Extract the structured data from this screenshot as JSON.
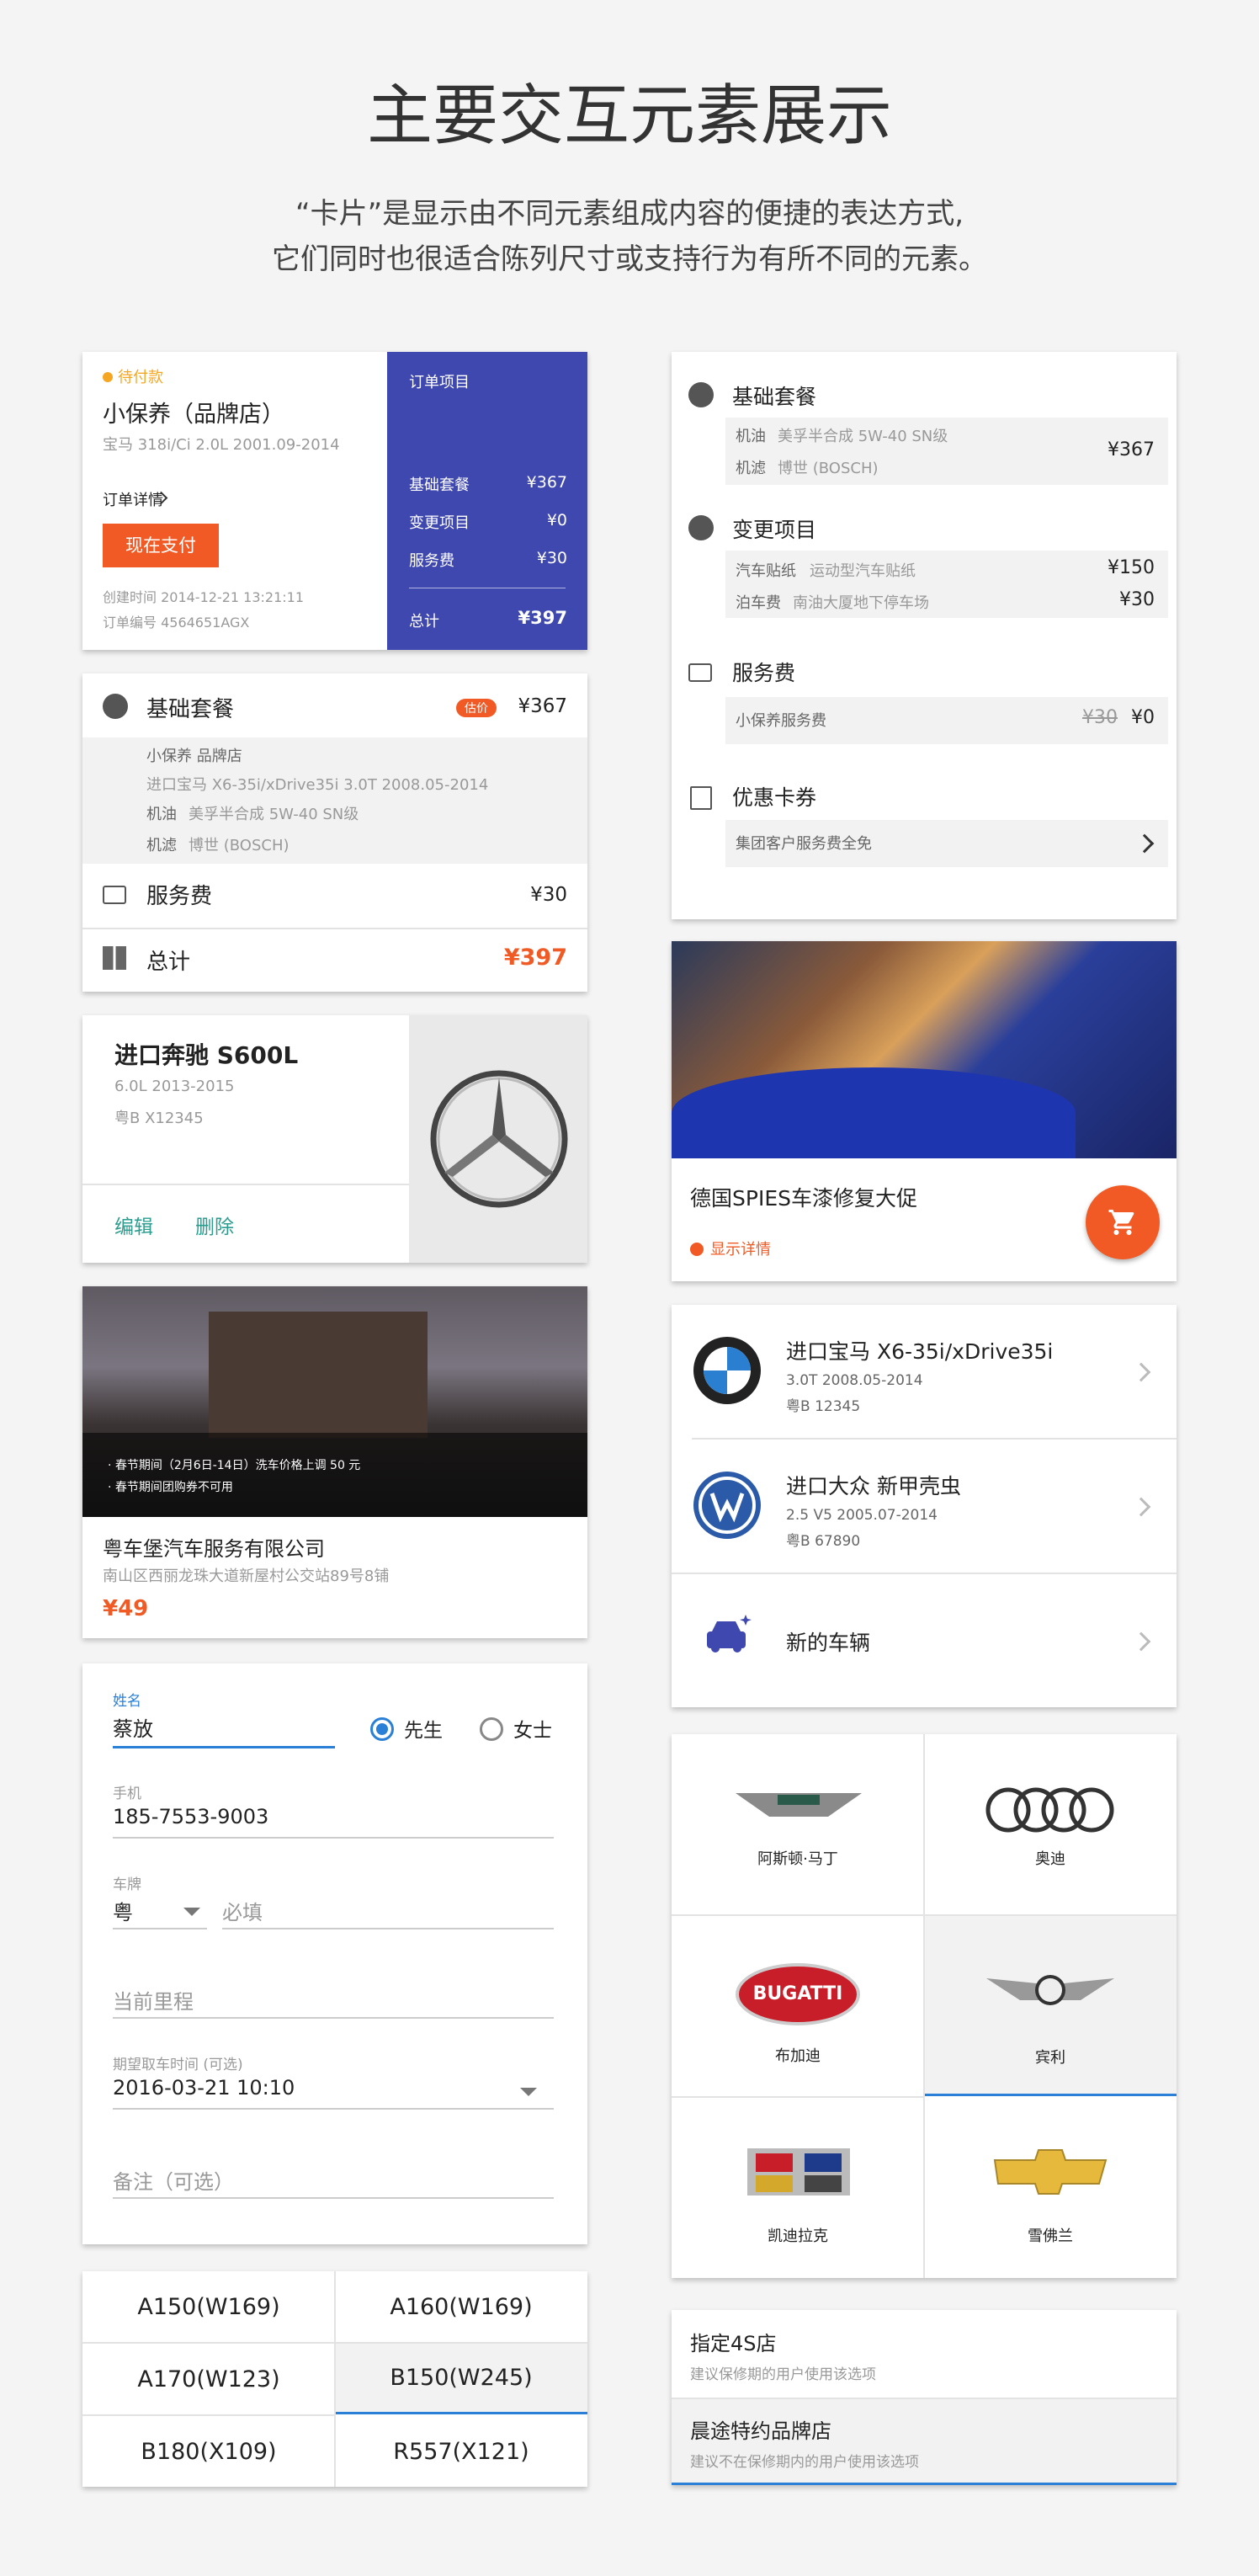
{
  "header": {
    "title": "主要交互元素展示",
    "line1": "“卡片”是显示由不同元素组成内容的便捷的表达方式,",
    "line2": "它们同时也很适合陈列尺寸或支持行为有所不同的元素。"
  },
  "order": {
    "status": "待付款",
    "title": "小保养（品牌店）",
    "car": "宝马 318i/Ci 2.0L 2001.09-2014",
    "details": "订单详情",
    "pay": "现在支付",
    "created": "创建时间 2014-12-21 13:21:11",
    "number": "订单编号 4564651AGX",
    "panel_title": "订单项目",
    "rows": [
      {
        "k": "基础套餐",
        "v": "¥367"
      },
      {
        "k": "变更项目",
        "v": "¥0"
      },
      {
        "k": "服务费",
        "v": "¥30"
      }
    ],
    "total_k": "总计",
    "total_v": "¥397"
  },
  "basic": {
    "title": "基础套餐",
    "badge": "估价",
    "price": "¥367",
    "lines": [
      "小保养 品牌店",
      "进口宝马 X6-35i/xDrive35i 3.0T 2008.05-2014"
    ],
    "oil_k": "机油",
    "oil_v": "美孚半合成 5W-40 SN级",
    "filter_k": "机滤",
    "filter_v": "博世 (BOSCH)",
    "service": "服务费",
    "service_v": "¥30",
    "total": "总计",
    "total_v": "¥397"
  },
  "benz": {
    "title": "进口奔驰 S600L",
    "spec": "6.0L 2013-2015",
    "plate": "粤B X12345",
    "edit": "编辑",
    "delete": "删除"
  },
  "wash": {
    "note1": "· 春节期间（2月6日-14日）洗车价格上调 50 元",
    "note2": "· 春节期间团购券不可用",
    "name": "粤车堡汽车服务有限公司",
    "addr": "南山区西丽龙珠大道新屋村公交站89号8铺",
    "price": "¥49"
  },
  "form": {
    "name_label": "姓名",
    "name_value": "蔡放",
    "mr": "先生",
    "ms": "女士",
    "phone_label": "手机",
    "phone_value": "185-7553-9003",
    "plate_label": "车牌",
    "province": "粤",
    "plate_ph": "必填",
    "mileage_ph": "当前里程",
    "time_label": "期望取车时间 (可选)",
    "time_value": "2016-03-21 10:10",
    "note_ph": "备注（可选）"
  },
  "models": [
    "A150(W169)",
    "A160(W169)",
    "A170(W123)",
    "B150(W245)",
    "B180(X109)",
    "R557(X121)"
  ],
  "summary": {
    "basic": "基础套餐",
    "oil_k": "机油",
    "oil_v": "美孚半合成 5W-40 SN级",
    "filter_k": "机滤",
    "filter_v": "博世 (BOSCH)",
    "basic_price": "¥367",
    "change": "变更项目",
    "c1_k": "汽车贴纸",
    "c1_v": "运动型汽车贴纸",
    "c1_p": "¥150",
    "c2_k": "泊车费",
    "c2_v": "南油大厦地下停车场",
    "c2_p": "¥30",
    "service": "服务费",
    "s_k": "小保养服务费",
    "s_old": "¥30",
    "s_new": "¥0",
    "coupon": "优惠卡券",
    "coupon_v": "集团客户服务费全免"
  },
  "promo": {
    "title": "德国SPIES车漆修复大促",
    "more": "显示详情"
  },
  "cars": [
    {
      "name": "进口宝马 X6-35i/xDrive35i",
      "spec": "3.0T 2008.05-2014",
      "plate": "粤B 12345"
    },
    {
      "name": "进口大众 新甲壳虫",
      "spec": "2.5 V5 2005.07-2014",
      "plate": "粤B 67890"
    },
    {
      "name": "新的车辆"
    }
  ],
  "brands": [
    "阿斯顿·马丁",
    "奥迪",
    "布加迪",
    "宾利",
    "凯迪拉克",
    "雪佛兰"
  ],
  "bugatti_logo": "BUGATTI",
  "shops": [
    {
      "title": "指定4S店",
      "sub": "建议保修期的用户使用该选项"
    },
    {
      "title": "晨途特约品牌店",
      "sub": "建议不在保修期内的用户使用该选项"
    }
  ],
  "colors": {
    "accent": "#f15a24",
    "panel": "#3f48ae",
    "select": "#2a7fd6",
    "teal": "#2a9d8f"
  }
}
